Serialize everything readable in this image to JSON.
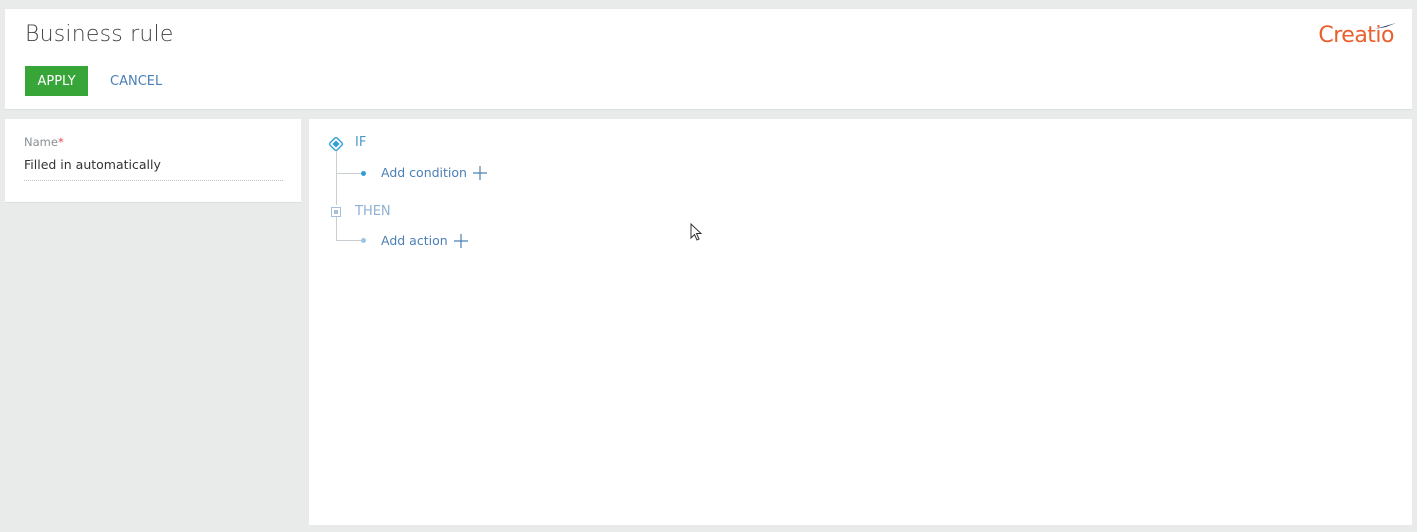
{
  "header": {
    "title": "Business rule",
    "logo_text": "Creatio",
    "apply_label": "APPLY",
    "cancel_label": "CANCEL"
  },
  "name_field": {
    "label": "Name",
    "required_mark": "*",
    "value": "Filled in automatically"
  },
  "rule": {
    "if_label": "IF",
    "add_condition_label": "Add condition",
    "then_label": "THEN",
    "add_action_label": "Add action"
  },
  "colors": {
    "apply_button": "#37a537",
    "link": "#4b7fb5",
    "if_accent": "#4b9bd2",
    "brand": "#ea5f2d"
  },
  "icons": [
    "diamond-icon",
    "square-icon",
    "plus-icon",
    "mouse-cursor-icon",
    "creatio-logo"
  ]
}
